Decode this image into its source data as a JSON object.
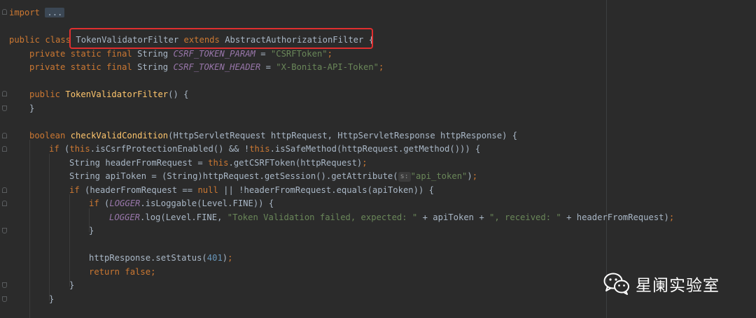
{
  "editor": {
    "l1": {
      "kw": "import",
      "fold": "..."
    },
    "l3": {
      "kw1": "public",
      "kw2": "class",
      "name": "TokenValidatorFilter",
      "kw3": "extends",
      "parent": "AbstractAuthorizationFilter",
      "brace": "{"
    },
    "l4": {
      "kw": "private static final",
      "type": "String",
      "const": "CSRF_TOKEN_PARAM",
      "eq": "=",
      "str": "\"CSRFToken\"",
      "end": ";"
    },
    "l5": {
      "kw": "private static final",
      "type": "String",
      "const": "CSRF_TOKEN_HEADER",
      "eq": "=",
      "str": "\"X-Bonita-API-Token\"",
      "end": ";"
    },
    "l7": {
      "kw": "public",
      "fn": "TokenValidatorFilter",
      "rest": "() {"
    },
    "l8": {
      "text": "}"
    },
    "l10": {
      "kw": "boolean",
      "fn": "checkValidCondition",
      "rest": "(HttpServletRequest httpRequest, HttpServletResponse httpResponse) {"
    },
    "l11": {
      "kw1": "if",
      "p1": " (",
      "kw2": "this",
      "p2": ".isCsrfProtectionEnabled() && !",
      "kw3": "this",
      "p3": ".isSafeMethod(httpRequest.getMethod())) {"
    },
    "l12": {
      "p1": "String headerFromRequest = ",
      "kw": "this",
      "p2": ".getCSRFToken(httpRequest)",
      "end": ";"
    },
    "l13": {
      "p1": "String apiToken = (String)httpRequest.getSession().getAttribute(",
      "hint": "s:",
      "str": "\"api_token\"",
      "p2": ")",
      "end": ";"
    },
    "l14": {
      "kw1": "if",
      "p1": " (headerFromRequest == ",
      "kw2": "null",
      "p2": " || !headerFromRequest.equals(apiToken)) {"
    },
    "l15": {
      "kw": "if",
      "p1": " (",
      "const": "LOGGER",
      "p2": ".isLoggable(Level.FINE)) {"
    },
    "l16": {
      "const": "LOGGER",
      "p1": ".log(Level.FINE, ",
      "str1": "\"Token Validation failed, expected: \"",
      "p2": " + apiToken + ",
      "str2": "\", received: \"",
      "p3": " + headerFromRequest)",
      "end": ";"
    },
    "l17": {
      "text": "}"
    },
    "l19": {
      "p1": "httpResponse.setStatus(",
      "num": "401",
      "p2": ")",
      "end": ";"
    },
    "l20": {
      "kw": "return false",
      "end": ";"
    },
    "l21": {
      "text": "}"
    },
    "l22": {
      "text": "}"
    }
  },
  "watermark": {
    "text": "星阑实验室",
    "icon": "wechat-icon"
  },
  "colors": {
    "keyword": "#cc7832",
    "function": "#ffc66d",
    "string": "#6a8759",
    "constant": "#9876aa",
    "number": "#6897bb",
    "highlight": "#e02f2f"
  }
}
